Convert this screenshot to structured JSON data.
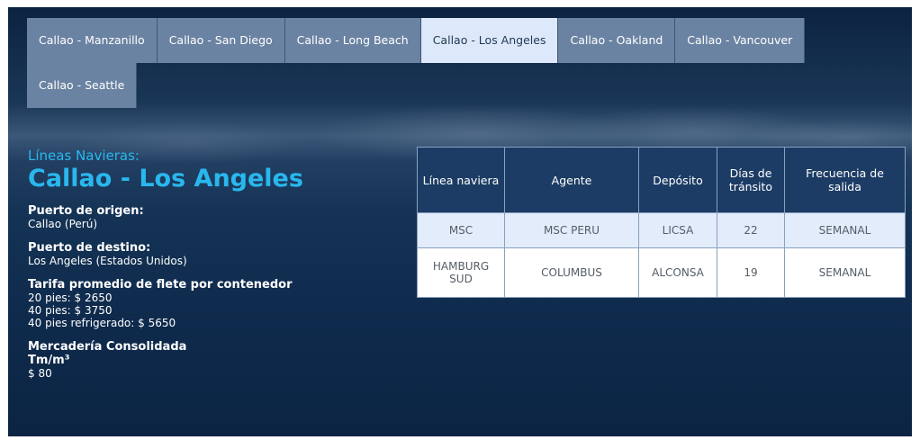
{
  "tabs": [
    {
      "label": "Callao - Manzanillo",
      "active": false
    },
    {
      "label": "Callao - San Diego",
      "active": false
    },
    {
      "label": "Callao - Long Beach",
      "active": false
    },
    {
      "label": "Callao - Los Angeles",
      "active": true
    },
    {
      "label": "Callao - Oakland",
      "active": false
    },
    {
      "label": "Callao - Vancouver",
      "active": false
    },
    {
      "label": "Callao - Seattle",
      "active": false
    }
  ],
  "heading": {
    "lead": "Líneas Navieras:",
    "route": "Callao - Los Angeles"
  },
  "origin": {
    "label": "Puerto de origen:",
    "value": "Callao (Perú)"
  },
  "destination": {
    "label": "Puerto de destino:",
    "value": "Los Angeles (Estados Unidos)"
  },
  "tariff": {
    "label": "Tarifa promedio de flete por contenedor",
    "lines": [
      "20 pies: $ 2650",
      "40 pies: $ 3750",
      "40 pies refrigerado: $ 5650"
    ]
  },
  "consolidated": {
    "label": "Mercadería Consolidada",
    "unit": "Tm/m³",
    "value": "$ 80"
  },
  "table": {
    "headers": [
      "Línea naviera",
      "Agente",
      "Depósito",
      "Días de tránsito",
      "Frecuencia de salida"
    ],
    "rows": [
      [
        "MSC",
        "MSC PERU",
        "LICSA",
        "22",
        "SEMANAL"
      ],
      [
        "HAMBURG SUD",
        "COLUMBUS",
        "ALCONSA",
        "19",
        "SEMANAL"
      ]
    ]
  },
  "colors": {
    "accent": "#29b8ee",
    "tab": "#6b83a2",
    "tab_active": "#dde9fa",
    "table_header": "#1c3c65",
    "table_row_alt": "#e2ecfa"
  }
}
